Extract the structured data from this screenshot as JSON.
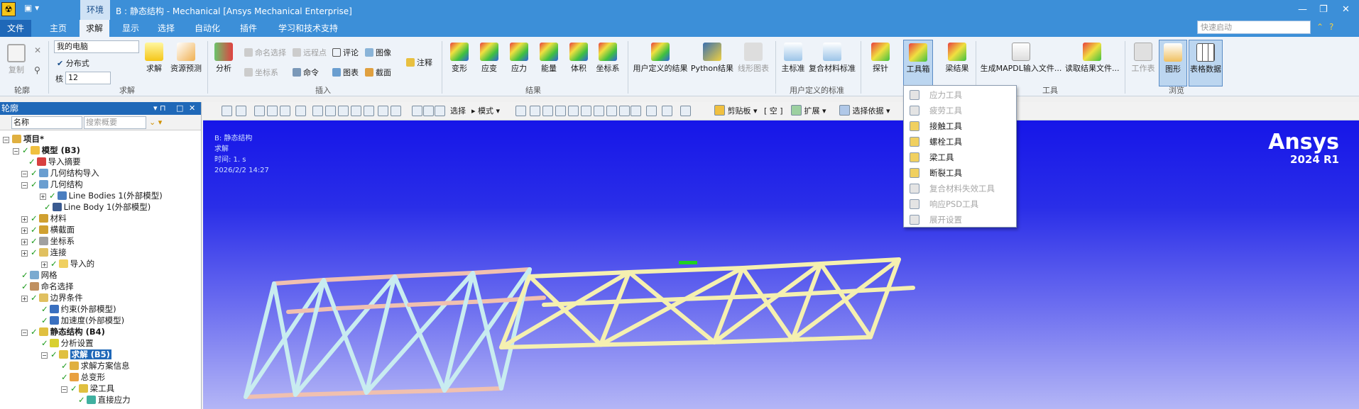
{
  "titlebar": {
    "qat": "▣ ▾",
    "context_tab": "环境",
    "window_title": "B : 静态结构 - Mechanical [Ansys Mechanical Enterprise]",
    "min": "—",
    "restore": "❐",
    "close": "✕"
  },
  "tabs": {
    "file": "文件",
    "home": "主页",
    "solve": "求解",
    "display": "显示",
    "select": "选择",
    "automation": "自动化",
    "plugins": "插件",
    "learn": "学习和技术支持",
    "quick_launch_placeholder": "快速启动"
  },
  "ribbon": {
    "outline_group": {
      "copy": "复制",
      "label": "轮廓"
    },
    "solve_group": {
      "env": "我的电脑",
      "distributed": "分布式",
      "cores_label": "核",
      "cores": "12",
      "solve": "求解",
      "resource": "资源预测",
      "label": "求解"
    },
    "insert_group": {
      "analysis": "分析",
      "named_sel": "命名选择",
      "remote_pt": "远程点",
      "comment": "评论",
      "image": "图像",
      "coord": "坐标系",
      "command": "命令",
      "chart": "图表",
      "section": "截面",
      "annotation": "注释",
      "label": "插入"
    },
    "results_group": {
      "deformation": "变形",
      "strain": "应变",
      "stress": "应力",
      "energy": "能量",
      "volume": "体积",
      "coordsys": "坐标系",
      "label": "结果"
    },
    "udr_group": {
      "user_results": "用户定义的结果",
      "python": "Python结果",
      "line_chart": "线形图表"
    },
    "criteria_group": {
      "main": "主标准",
      "composite": "复合材料标准",
      "label": "用户定义的标准"
    },
    "probe": "探针",
    "toolbox": "工具箱",
    "beam_results": "梁结果",
    "tools_group": {
      "gen_mapdl": "生成MAPDL输入文件...",
      "read_results": "读取结果文件...",
      "label": "工具"
    },
    "browse_group": {
      "worksheet": "工作表",
      "graph": "图形",
      "tabular": "表格数据",
      "label": "浏览"
    }
  },
  "outline": {
    "title": "轮廓",
    "filter_name": "名称",
    "search_placeholder": "搜索概要",
    "nodes": [
      {
        "t": "项目*",
        "bold": true
      },
      {
        "t": "模型 (B3)",
        "bold": true
      },
      {
        "t": "导入摘要"
      },
      {
        "t": "几何结构导入"
      },
      {
        "t": "几何结构"
      },
      {
        "t": "Line Bodies 1(外部模型)"
      },
      {
        "t": "Line Body 1(外部模型)"
      },
      {
        "t": "材料"
      },
      {
        "t": "横截面"
      },
      {
        "t": "坐标系"
      },
      {
        "t": "连接"
      },
      {
        "t": "导入的"
      },
      {
        "t": "网格"
      },
      {
        "t": "命名选择"
      },
      {
        "t": "边界条件"
      },
      {
        "t": "约束(外部模型)"
      },
      {
        "t": "加速度(外部模型)"
      },
      {
        "t": "静态结构 (B4)",
        "bold": true
      },
      {
        "t": "分析设置"
      },
      {
        "t": "求解 (B5)",
        "selected": true
      },
      {
        "t": "求解方案信息"
      },
      {
        "t": "总变形"
      },
      {
        "t": "梁工具"
      },
      {
        "t": "直接应力"
      }
    ]
  },
  "viewtoolbar": {
    "select": "选择",
    "mode": "模式",
    "clipboard": "剪贴板",
    "empty": "[ 空 ]",
    "extend": "扩展",
    "select_by": "选择依据"
  },
  "viewport": {
    "info1": "B: 静态结构",
    "info2": "求解",
    "info3": "时间: 1. s",
    "info4": "2026/2/2 14:27",
    "brand": "Ansys",
    "version": "2024 R1"
  },
  "toolbox_menu": [
    {
      "label": "应力工具",
      "enabled": false
    },
    {
      "label": "疲劳工具",
      "enabled": false
    },
    {
      "label": "接触工具",
      "enabled": true
    },
    {
      "label": "螺栓工具",
      "enabled": true
    },
    {
      "label": "梁工具",
      "enabled": true
    },
    {
      "label": "断裂工具",
      "enabled": true
    },
    {
      "label": "复合材料失效工具",
      "enabled": false
    },
    {
      "label": "响应PSD工具",
      "enabled": false
    },
    {
      "label": "展开设置",
      "enabled": false
    }
  ],
  "colors": {
    "accent": "#3c8fd8",
    "selected": "#1f68b8",
    "truss_salmon": "#f0c0b0",
    "truss_cyan": "#c8ecf0",
    "truss_yellow": "#f5f0b0"
  }
}
